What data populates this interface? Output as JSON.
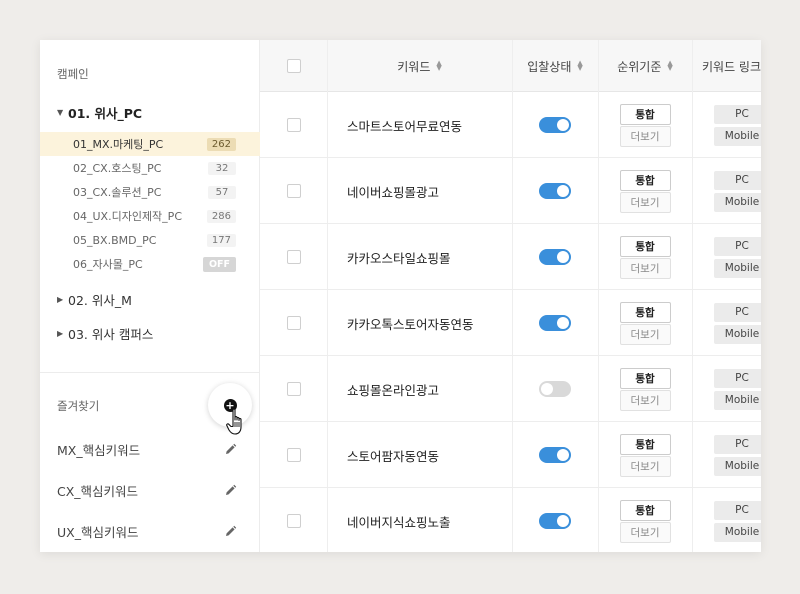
{
  "sidebar": {
    "title": "캠페인",
    "group_open": "01. 위사_PC",
    "sub_items": [
      {
        "label": "01_MX.마케팅_PC",
        "count": "262"
      },
      {
        "label": "02_CX.호스팅_PC",
        "count": "32"
      },
      {
        "label": "03_CX.솔루션_PC",
        "count": "57"
      },
      {
        "label": "04_UX.디자인제작_PC",
        "count": "286"
      },
      {
        "label": "05_BX.BMD_PC",
        "count": "177"
      },
      {
        "label": "06_자사몰_PC",
        "count": "OFF"
      }
    ],
    "group2": "02. 위사_M",
    "group3": "03. 위사 캠퍼스",
    "fav_title": "즐겨찾기",
    "favorites": [
      "MX_핵심키워드",
      "CX_핵심키워드",
      "UX_핵심키워드"
    ]
  },
  "table": {
    "headers": {
      "keyword": "키워드",
      "bid_status": "입찰상태",
      "rank_basis": "순위기준",
      "keyword_link": "키워드 링크"
    },
    "rank_primary": "통합",
    "rank_more": "더보기",
    "link_pc": "PC",
    "link_mobile": "Mobile",
    "rows": [
      {
        "keyword": "스마트스토어무료연동",
        "bid_on": true
      },
      {
        "keyword": "네이버쇼핑몰광고",
        "bid_on": true
      },
      {
        "keyword": "카카오스타일쇼핑몰",
        "bid_on": true
      },
      {
        "keyword": "카카오톡스토어자동연동",
        "bid_on": true
      },
      {
        "keyword": "쇼핑몰온라인광고",
        "bid_on": false
      },
      {
        "keyword": "스토어팜자동연동",
        "bid_on": true
      },
      {
        "keyword": "네이버지식쇼핑노출",
        "bid_on": true
      }
    ]
  },
  "colors": {
    "accent": "#3a8fdb",
    "active_bg": "#fcf3dc",
    "background": "#efedea"
  },
  "icons": {
    "add": "plus-circle-icon",
    "edit": "pencil-icon",
    "cursor": "hand-pointer-icon",
    "sort": "sort-arrows-icon"
  }
}
